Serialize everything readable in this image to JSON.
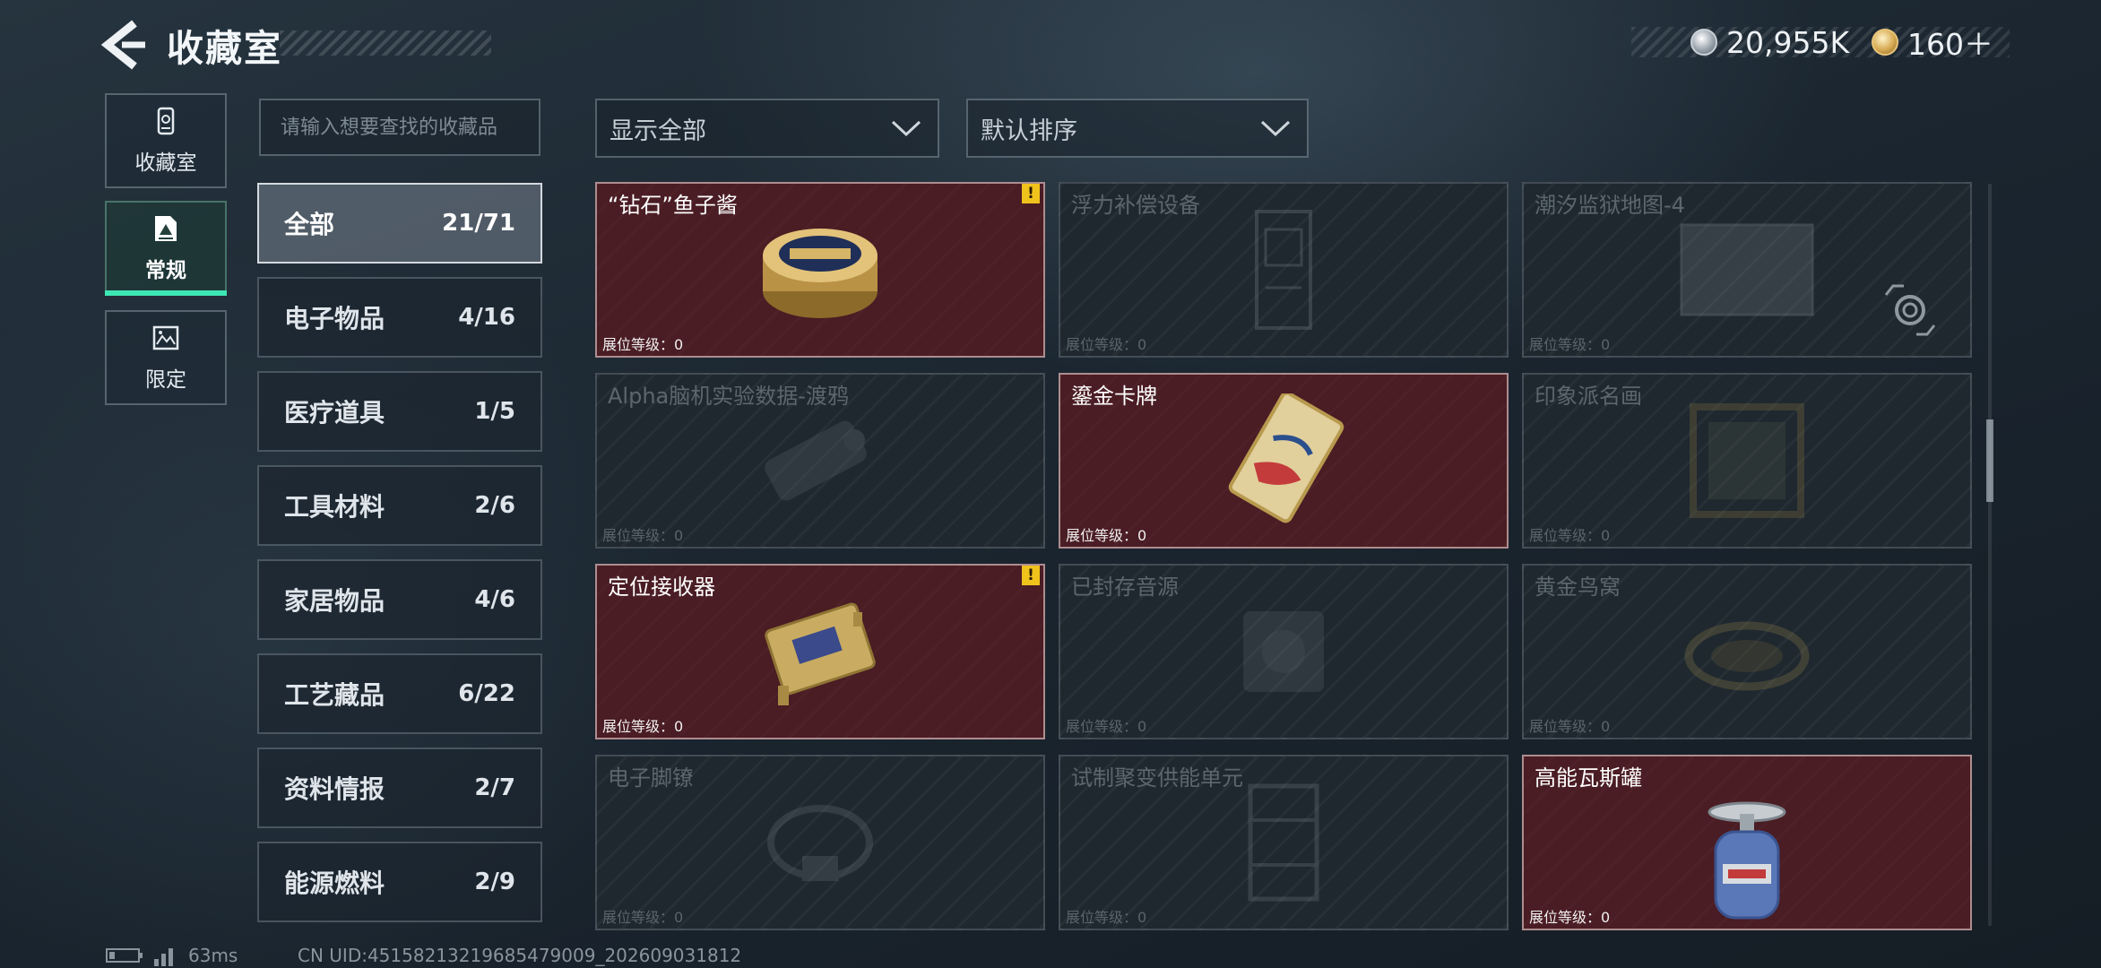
{
  "header": {
    "title": "收藏室",
    "silver_amount": "20,955K",
    "gold_amount": "160＋"
  },
  "nav": [
    {
      "label": "收藏室",
      "icon": "collection-icon"
    },
    {
      "label": "常规",
      "icon": "regular-icon",
      "active": true
    },
    {
      "label": "限定",
      "icon": "limited-icon"
    }
  ],
  "search": {
    "placeholder": "请输入想要查找的收藏品",
    "value": ""
  },
  "filters": {
    "display": "显示全部",
    "sort": "默认排序"
  },
  "categories": [
    {
      "name": "全部",
      "count": "21/71",
      "active": true
    },
    {
      "name": "电子物品",
      "count": "4/16"
    },
    {
      "name": "医疗道具",
      "count": "1/5"
    },
    {
      "name": "工具材料",
      "count": "2/6"
    },
    {
      "name": "家居物品",
      "count": "4/6"
    },
    {
      "name": "工艺藏品",
      "count": "6/22"
    },
    {
      "name": "资料情报",
      "count": "2/7"
    },
    {
      "name": "能源燃料",
      "count": "2/9"
    }
  ],
  "level_label": "展位等级：",
  "items": [
    {
      "name": "“钻石”鱼子酱",
      "level": "0",
      "owned": true,
      "alert": true,
      "icon": "caviar-tin-icon"
    },
    {
      "name": "浮力补偿设备",
      "level": "0",
      "owned": false,
      "icon": "buoyancy-device-icon"
    },
    {
      "name": "潮汐监狱地图-4",
      "level": "0",
      "owned": false,
      "icon": "map-icon"
    },
    {
      "name": "Alpha脑机实验数据-渡鸦",
      "level": "0",
      "owned": false,
      "icon": "data-drive-icon"
    },
    {
      "name": "鎏金卡牌",
      "level": "0",
      "owned": true,
      "icon": "gilded-card-icon"
    },
    {
      "name": "印象派名画",
      "level": "0",
      "owned": false,
      "icon": "painting-icon"
    },
    {
      "name": "定位接收器",
      "level": "0",
      "owned": true,
      "alert": true,
      "icon": "receiver-icon"
    },
    {
      "name": "已封存音源",
      "level": "0",
      "owned": false,
      "icon": "audio-source-icon"
    },
    {
      "name": "黄金鸟窝",
      "level": "0",
      "owned": false,
      "icon": "bird-nest-icon"
    },
    {
      "name": "电子脚镣",
      "level": "0",
      "owned": false,
      "icon": "ankle-monitor-icon"
    },
    {
      "name": "试制聚变供能单元",
      "level": "0",
      "owned": false,
      "icon": "fusion-unit-icon"
    },
    {
      "name": "高能瓦斯罐",
      "level": "0",
      "owned": true,
      "icon": "gas-canister-icon"
    }
  ],
  "alert_glyph": "!",
  "status_bar": {
    "ping": "63ms",
    "uid": "CN UID:4515821321968547900​9_202609031812"
  }
}
